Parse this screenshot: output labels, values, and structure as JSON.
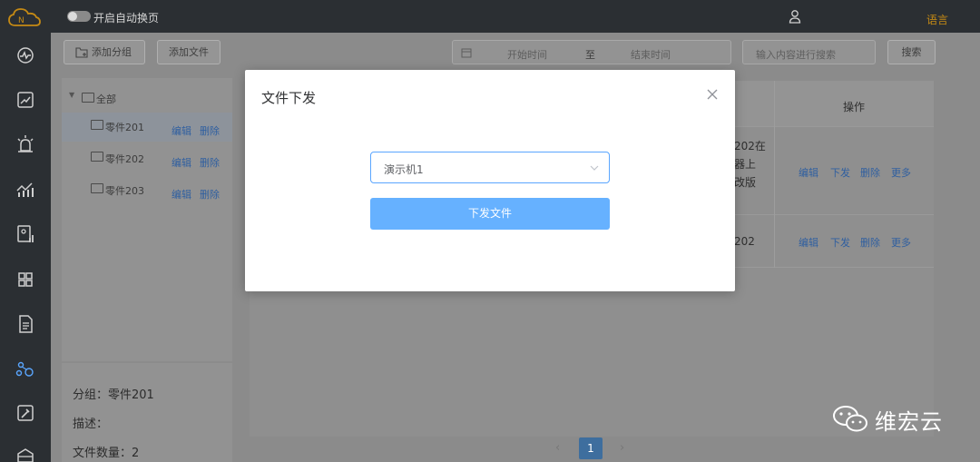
{
  "header": {
    "auto_switch_label": "开启自动换页",
    "language_label": "语言"
  },
  "sidebar": {
    "icons": [
      "monitor-icon",
      "trend-icon",
      "alarm-icon",
      "statistics-icon",
      "report-icon",
      "apps-icon",
      "document-icon",
      "network-icon",
      "tools-icon",
      "package-icon"
    ]
  },
  "toolbar": {
    "add_group_label": "添加分组",
    "add_file_label": "添加文件",
    "start_time_placeholder": "开始时间",
    "range_separator": "至",
    "end_time_placeholder": "结束时间",
    "search_placeholder": "输入内容进行搜索",
    "search_button": "搜索"
  },
  "tree": {
    "root_label": "全部",
    "items": [
      {
        "label": "零件201",
        "edit": "编辑",
        "delete": "删除"
      },
      {
        "label": "零件202",
        "edit": "编辑",
        "delete": "删除"
      },
      {
        "label": "零件203",
        "edit": "编辑",
        "delete": "删除"
      }
    ]
  },
  "group_info": {
    "group_line": "分组：零件201",
    "desc_line": "描述：",
    "count_line": "文件数量：2"
  },
  "table": {
    "ops_header": "操作",
    "row1_text_lines": [
      "202在",
      "器上",
      "改版"
    ],
    "row2_text": "202",
    "ops": {
      "edit": "编辑",
      "send": "下发",
      "delete": "删除",
      "more": "更多"
    }
  },
  "pagination": {
    "current_page": "1",
    "prev": "‹",
    "next": "›"
  },
  "modal": {
    "title": "文件下发",
    "selected_device": "演示机1",
    "submit_label": "下发文件"
  },
  "watermark": {
    "text": "维宏云"
  },
  "colors": {
    "primary": "#66b1ff",
    "select_border": "#5aa6ff",
    "language_accent": "#c58a14",
    "rail_bg": "#2b2f33"
  }
}
